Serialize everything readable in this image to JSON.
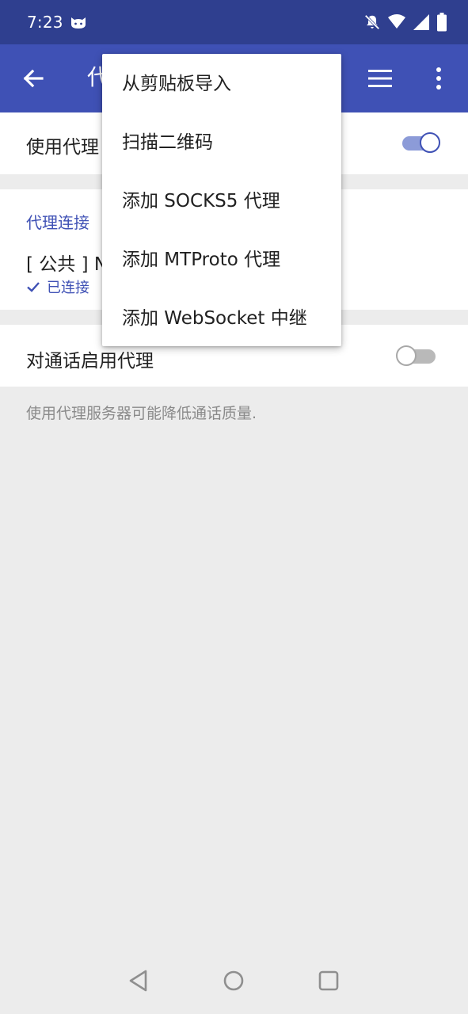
{
  "status_bar": {
    "time": "7:23",
    "app_icon": "cat-face-icon",
    "icons": [
      "bell-off-icon",
      "wifi-icon",
      "signal-icon",
      "battery-icon"
    ]
  },
  "app_bar": {
    "title": "代理设置",
    "back_icon": "arrow-left-icon",
    "list_icon": "list-icon",
    "more_icon": "more-vertical-icon"
  },
  "settings": {
    "use_proxy_label": "使用代理",
    "use_proxy_on": true,
    "proxy_section_title": "代理连接",
    "proxy_name": "[ 公共 ] N",
    "proxy_status": "已连接",
    "calls_label": "对通话启用代理",
    "calls_on": false,
    "calls_note": "使用代理服务器可能降低通话质量."
  },
  "menu": {
    "items": [
      "从剪贴板导入",
      "扫描二维码",
      "添加 SOCKS5 代理",
      "添加 MTProto 代理",
      "添加 WebSocket 中继"
    ]
  },
  "nav_bar": {
    "icons": [
      "back-triangle-icon",
      "home-circle-icon",
      "recents-square-icon"
    ]
  },
  "colors": {
    "status_bar": "#2f3f8f",
    "app_bar": "#3f51b5",
    "accent": "#3f51b5",
    "toggle_on_track": "#8c9bd8",
    "background": "#ececec"
  }
}
